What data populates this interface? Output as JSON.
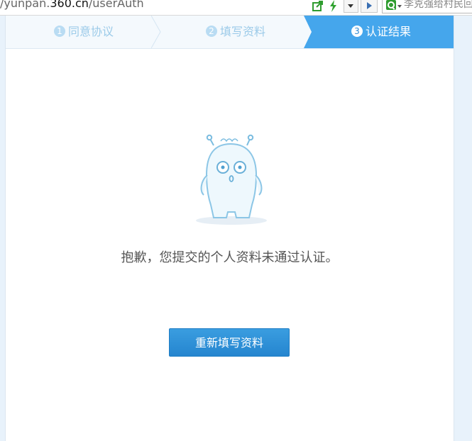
{
  "browser": {
    "url_prefix": "/yunpan.",
    "url_domain": "360.cn",
    "url_path": "/userAuth",
    "search_query": "李克强给村民回"
  },
  "steps": [
    {
      "number": "1",
      "label": "同意协议",
      "active": false
    },
    {
      "number": "2",
      "label": "填写资料",
      "active": false
    },
    {
      "number": "3",
      "label": "认证结果",
      "active": true
    }
  ],
  "result": {
    "message": "抱歉，您提交的个人资料未通过认证。",
    "retry_button": "重新填写资料"
  },
  "colors": {
    "accent": "#2d8ad4",
    "active_step": "#45a6ec",
    "inactive_step_text": "#9ccbe9",
    "page_background": "#e8f2fb"
  }
}
